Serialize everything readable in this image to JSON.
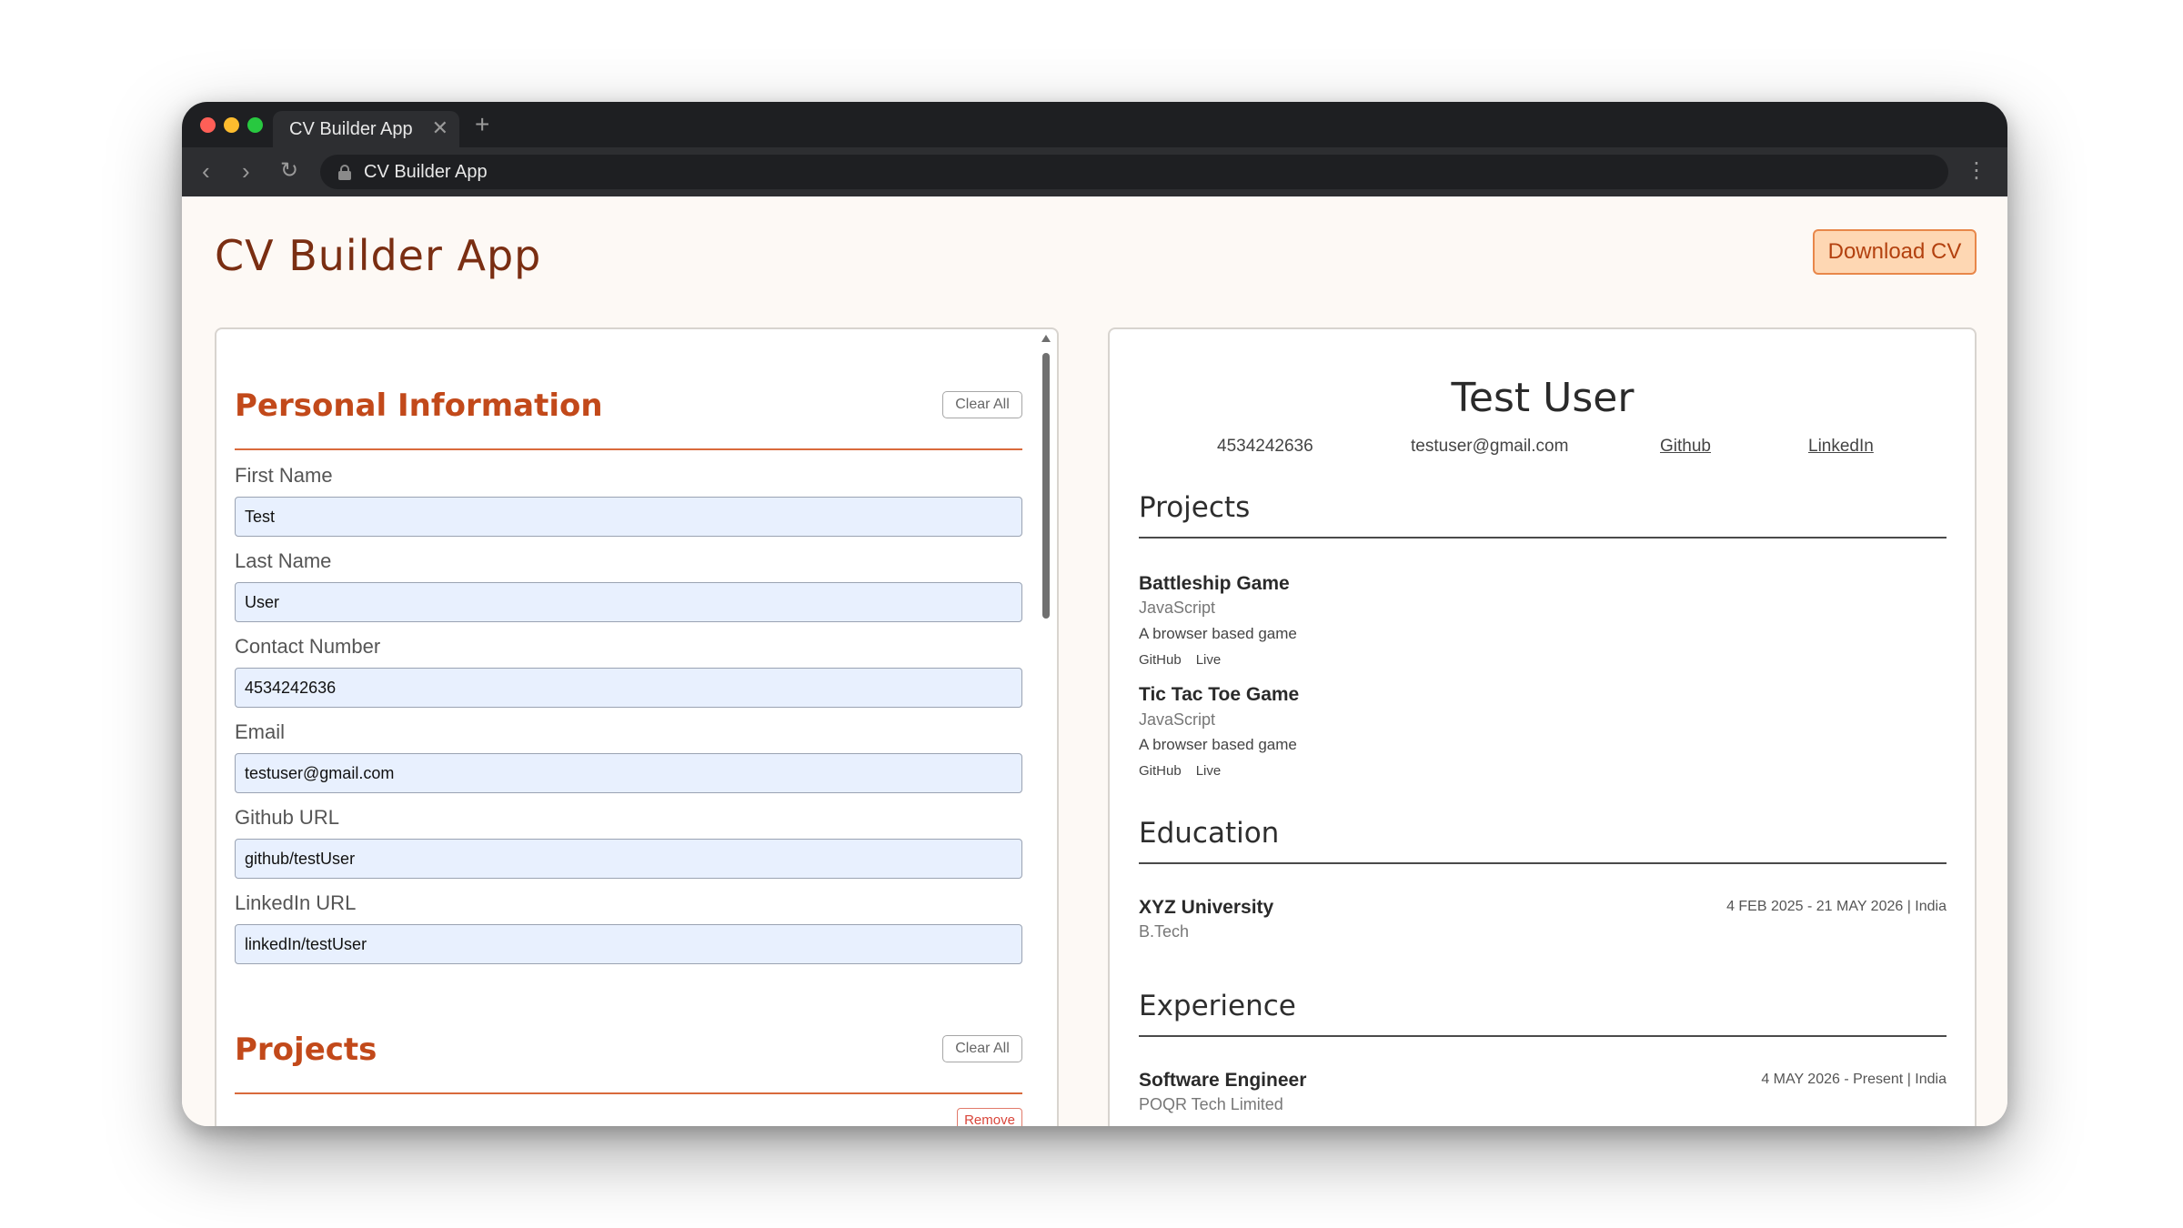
{
  "browser": {
    "tab_title": "CV Builder App",
    "tab_close": "✕",
    "new_tab": "+",
    "address": "CV Builder App",
    "back": "‹",
    "forward": "›",
    "reload": "↻",
    "menu": "⋮"
  },
  "header": {
    "title": "CV Builder App",
    "download_label": "Download CV"
  },
  "form": {
    "personal": {
      "title": "Personal Information",
      "clear_label": "Clear All",
      "fields": [
        {
          "label": "First Name",
          "value": "Test"
        },
        {
          "label": "Last Name",
          "value": "User"
        },
        {
          "label": "Contact Number",
          "value": "4534242636"
        },
        {
          "label": "Email",
          "value": "testuser@gmail.com"
        },
        {
          "label": "Github URL",
          "value": "github/testUser"
        },
        {
          "label": "LinkedIn URL",
          "value": "linkedIn/testUser"
        }
      ]
    },
    "projects": {
      "title": "Projects",
      "clear_label": "Clear All",
      "remove_label": "Remove"
    }
  },
  "preview": {
    "name": "Test User",
    "phone": "4534242636",
    "email": "testuser@gmail.com",
    "github": "Github",
    "linkedin": "LinkedIn",
    "projects_title": "Projects",
    "projects": [
      {
        "title": "Battleship Game",
        "tech": "JavaScript",
        "desc": "A browser based game",
        "link1": "GitHub",
        "link2": "Live"
      },
      {
        "title": "Tic Tac Toe Game",
        "tech": "JavaScript",
        "desc": "A browser based game",
        "link1": "GitHub",
        "link2": "Live"
      }
    ],
    "education_title": "Education",
    "education": [
      {
        "school": "XYZ University",
        "degree": "B.Tech",
        "meta": "4 FEB 2025 - 21 MAY 2026 | India"
      }
    ],
    "experience_title": "Experience",
    "experience": [
      {
        "role": "Software Engineer",
        "company": "POQR Tech Limited",
        "meta": "4 MAY 2026 - Present | India"
      }
    ]
  }
}
